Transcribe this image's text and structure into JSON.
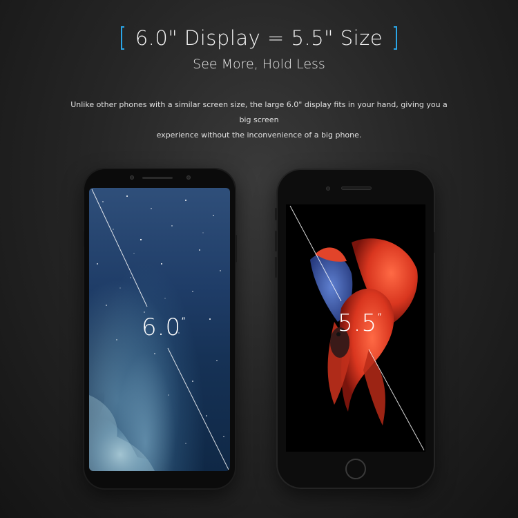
{
  "header": {
    "headline": "6.0\" Display = 5.5\" Size",
    "subheadline": "See More, Hold Less",
    "description_line1": "Unlike other phones with a similar screen size, the large 6.0\" display fits in your hand, giving you a big screen",
    "description_line2": "experience without the inconvenience of a big phone."
  },
  "phones": {
    "left": {
      "size_value": "6.0",
      "unit_mark": "″",
      "wallpaper": "starry-sky-ocean"
    },
    "right": {
      "size_value": "5.5",
      "unit_mark": "″",
      "wallpaper": "red-betta-fish"
    }
  },
  "colors": {
    "accent": "#2aa6e8",
    "background": "#262626",
    "fish_red": "#e0432b",
    "fish_blue": "#3f6fd0"
  }
}
